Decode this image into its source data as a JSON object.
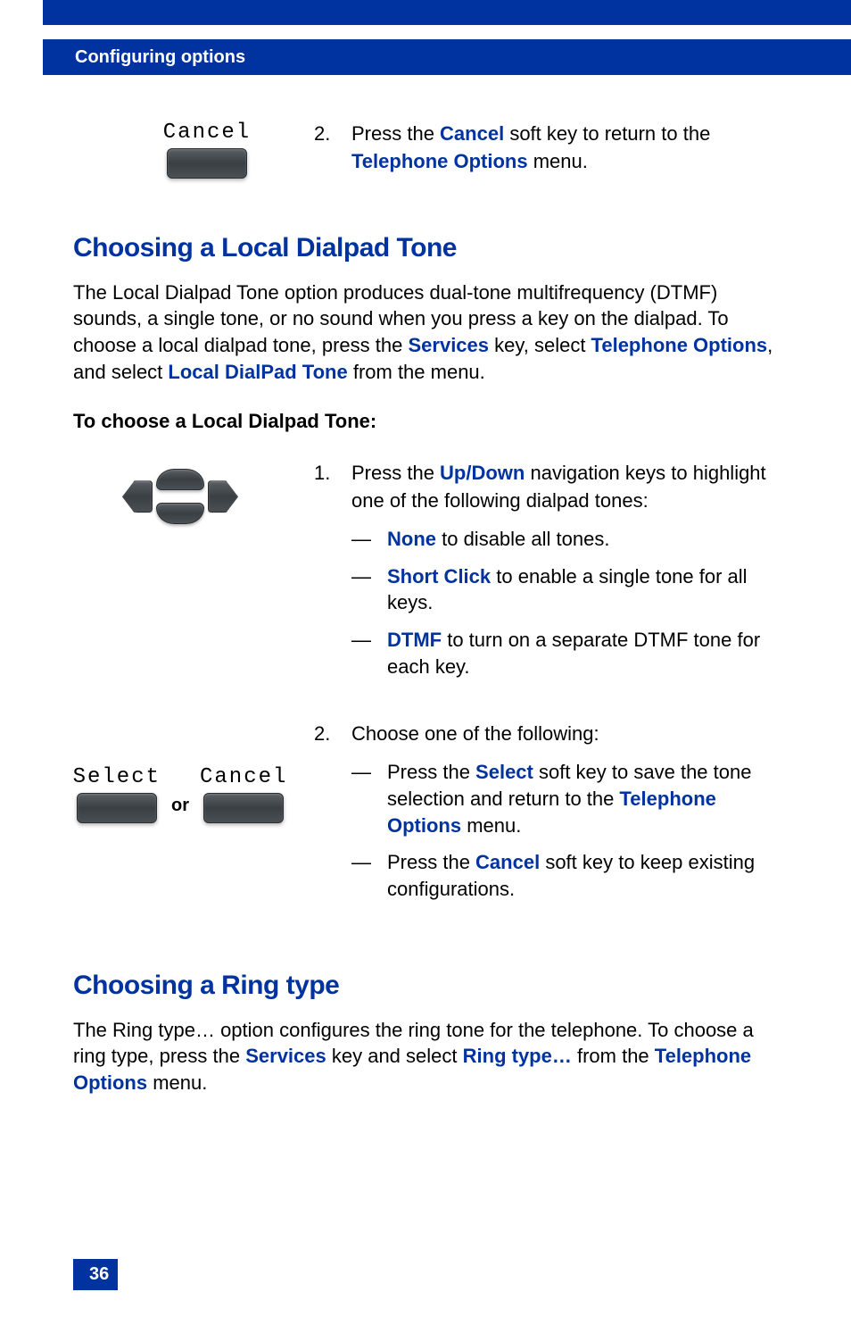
{
  "header": {
    "title": "Configuring options"
  },
  "page_number": "36",
  "step_top": {
    "softkey_label": "Cancel",
    "number": "2.",
    "text_parts": [
      "Press the ",
      "Cancel",
      " soft key to return to the ",
      "Telephone Options",
      " menu."
    ]
  },
  "section1": {
    "title": "Choosing a Local Dialpad Tone",
    "intro_parts": [
      "The Local Dialpad Tone option produces dual-tone multifrequency (DTMF) sounds, a single tone, or no sound when you press a key on the dialpad. To choose a local dialpad tone, press the ",
      "Services",
      " key, select ",
      "Telephone Options",
      ", and select ",
      "Local DialPad Tone",
      " from the menu."
    ],
    "subhead": "To choose a Local Dialpad Tone:",
    "step1": {
      "number": "1.",
      "intro_parts": [
        "Press the ",
        "Up/Down",
        " navigation keys to highlight one of the following dialpad tones:"
      ],
      "options": [
        {
          "label": "None",
          "text": " to disable all tones."
        },
        {
          "label": "Short Click",
          "text": " to enable a single tone for all keys."
        },
        {
          "label": "DTMF",
          "text": " to turn on a separate DTMF tone for each key."
        }
      ]
    },
    "step2": {
      "number": "2.",
      "intro": "Choose one of the following:",
      "softkey_select": "Select",
      "softkey_cancel": "Cancel",
      "or": "or",
      "options": [
        {
          "pre": "Press the ",
          "label": "Select",
          "mid": " soft key to save the tone selection and return to the ",
          "label2": "Telephone Options",
          "post": " menu."
        },
        {
          "pre": "Press the ",
          "label": "Cancel",
          "post": " soft key to keep existing configurations."
        }
      ]
    }
  },
  "section2": {
    "title": "Choosing a Ring type",
    "intro_parts": [
      "The Ring type… option configures the ring tone for the telephone. To choose a ring type, press the ",
      "Services",
      " key and select ",
      "Ring type…",
      " from the ",
      "Telephone Options",
      " menu."
    ]
  }
}
